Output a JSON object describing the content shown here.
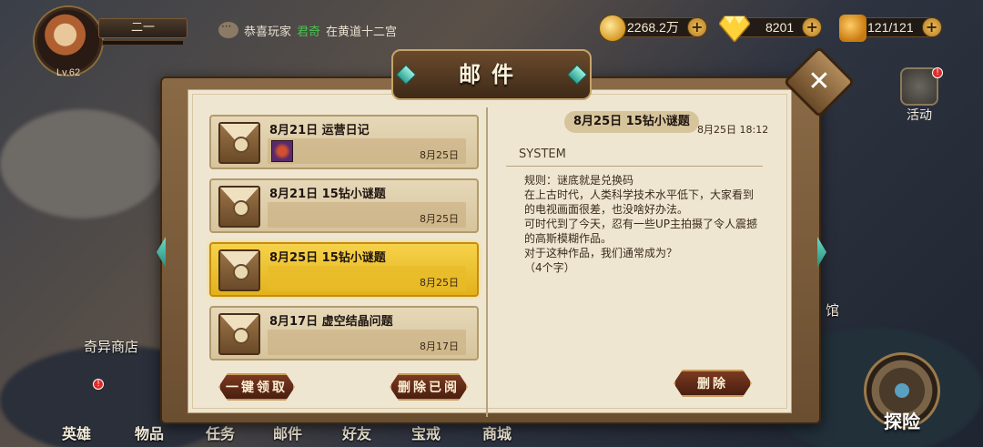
{
  "player": {
    "name": "二一",
    "level": "Lv.62"
  },
  "ticker": {
    "prefix": "恭喜玩家",
    "highlight": "君奇",
    "suffix": "在黄道十二宫"
  },
  "resources": {
    "gold": "2268.2万",
    "gems": "8201",
    "stamina": "121/121",
    "plus": "+"
  },
  "side": {
    "activity": "活动",
    "strange_shop": "奇异商店",
    "guan": "馆"
  },
  "bottom_nav": [
    "英雄",
    "物品",
    "任务",
    "邮件",
    "好友",
    "宝戒",
    "商城"
  ],
  "explore": "探险",
  "mail": {
    "title": "邮件",
    "close": "✕",
    "items": [
      {
        "title": "8月21日 运营日记",
        "date": "8月25日"
      },
      {
        "title": "8月21日 15钻小谜题",
        "date": "8月25日"
      },
      {
        "title": "8月25日 15钻小谜题",
        "date": "8月25日"
      },
      {
        "title": "8月17日 虚空结晶问题",
        "date": "8月17日"
      }
    ],
    "buttons": {
      "claim_all": "一键领取",
      "delete_read": "删除已阅",
      "delete": "删除"
    },
    "detail": {
      "subject": "8月25日 15钻小谜题",
      "time": "8月25日 18:12",
      "sender": "SYSTEM",
      "lines": [
        "规则：谜底就是兑换码",
        "",
        "在上古时代，人类科学技术水平低下，大家看到的电视画面很差，也没啥好办法。",
        "可时代到了今天，忍有一些UP主拍摄了令人震撼的高斯模糊作品。",
        "对于这种作品，我们通常成为？",
        "（4个字）"
      ]
    }
  },
  "colors": {
    "selected": "#f6d24a",
    "accent": "#c89a5a",
    "highlight_text": "#4cbf54"
  }
}
